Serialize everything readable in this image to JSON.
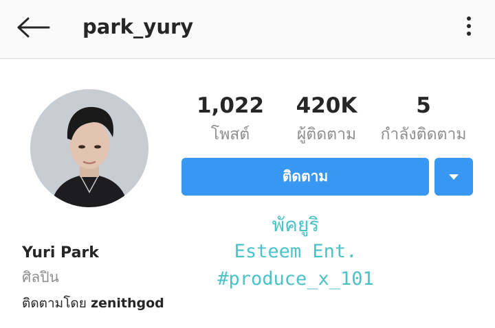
{
  "header": {
    "username": "park_yury",
    "back_icon": "arrow-left-icon",
    "more_icon": "more-vertical-icon"
  },
  "profile": {
    "avatar_icon": "profile-photo",
    "full_name": "Yuri Park",
    "category": "ศิลปิน",
    "followed_by_prefix": "ติดตามโดย",
    "followed_by_user": "zenithgod"
  },
  "stats": [
    {
      "value": "1,022",
      "label": "โพสต์"
    },
    {
      "value": "420K",
      "label": "ผู้ติดตาม"
    },
    {
      "value": "5",
      "label": "กำลังติดตาม"
    }
  ],
  "actions": {
    "follow_label": "ติดตาม",
    "dropdown_icon": "caret-down-icon"
  },
  "bio": {
    "line1": "พัคยูริ",
    "line2": "Esteem Ent.",
    "line3": "#produce_x_101"
  },
  "colors": {
    "accent": "#3897f0",
    "bio_text": "#4cc1c8",
    "secondary_text": "#8e8e8e"
  }
}
